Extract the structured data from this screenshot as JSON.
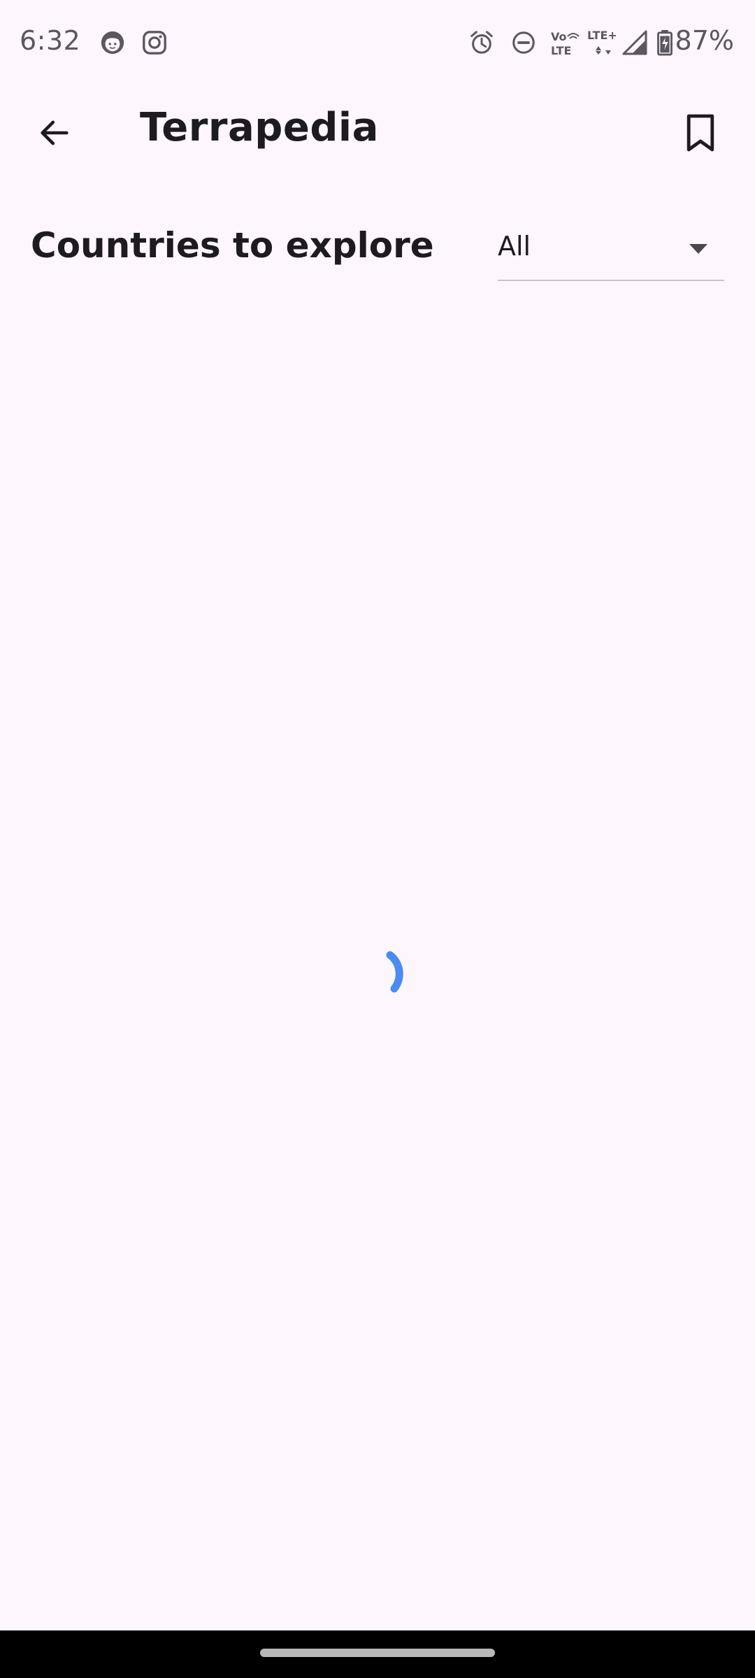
{
  "status_bar": {
    "time": "6:32",
    "battery": "87%",
    "volte_top": "Vo",
    "volte_bottom": "LTE",
    "lte_plus": "LTE+",
    "icons": [
      "face-app-icon",
      "instagram-icon",
      "alarm-icon",
      "do-not-disturb-icon",
      "volte-icon",
      "lte-plus-icon",
      "signal-icon",
      "battery-icon"
    ]
  },
  "app_bar": {
    "title": "Terrapedia",
    "back_icon": "arrow-back-icon",
    "bookmark_icon": "bookmark-icon"
  },
  "section": {
    "title": "Countries to explore",
    "filter": {
      "selected": "All"
    }
  },
  "loading": {
    "spinner_color": "#4a8cf0"
  },
  "colors": {
    "background": "#fdf6fc",
    "text": "#1e1b20",
    "accent": "#4a8cf0"
  }
}
